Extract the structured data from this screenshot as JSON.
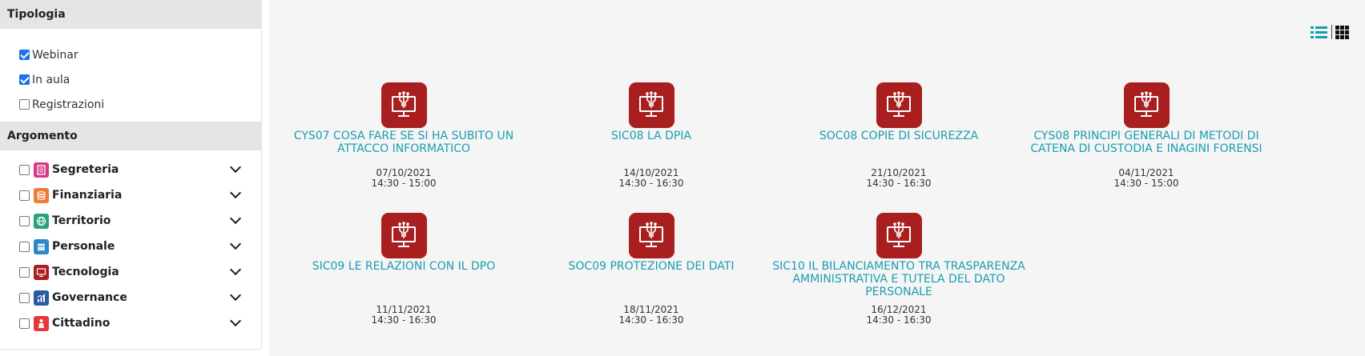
{
  "sidebar": {
    "typology": {
      "title": "Tipologia",
      "items": [
        {
          "label": "Webinar",
          "checked": true
        },
        {
          "label": "In aula",
          "checked": true
        },
        {
          "label": "Registrazioni",
          "checked": false
        }
      ]
    },
    "topic": {
      "title": "Argomento",
      "items": [
        {
          "label": "Segreteria",
          "color": "#d53b84",
          "icon": "document-icon"
        },
        {
          "label": "Finanziaria",
          "color": "#ee7b3a",
          "icon": "coins-icon"
        },
        {
          "label": "Territorio",
          "color": "#27a477",
          "icon": "globe-icon"
        },
        {
          "label": "Personale",
          "color": "#2d88c8",
          "icon": "people-icon"
        },
        {
          "label": "Tecnologia",
          "color": "#a91e1e",
          "icon": "computer-icon"
        },
        {
          "label": "Governance",
          "color": "#285aa6",
          "icon": "chart-icon"
        },
        {
          "label": "Cittadino",
          "color": "#e5373a",
          "icon": "person-icon"
        }
      ]
    }
  },
  "view_toggle": {
    "list_icon": "list-view-icon",
    "grid_icon": "grid-view-icon",
    "accent": "#1a9db0"
  },
  "courses": [
    {
      "title": "CYS07 COSA FARE SE SI HA SUBITO UN ATTACCO INFORMATICO",
      "date": "07/10/2021",
      "time": "14:30 - 15:00"
    },
    {
      "title": "SIC08 LA DPIA",
      "date": "14/10/2021",
      "time": "14:30 - 16:30"
    },
    {
      "title": "SOC08 COPIE DI SICUREZZA",
      "date": "21/10/2021",
      "time": "14:30 - 16:30"
    },
    {
      "title": "CYS08 PRINCIPI GENERALI DI METODI DI CATENA DI CUSTODIA E INAGINI FORENSI",
      "date": "04/11/2021",
      "time": "14:30 - 15:00"
    },
    {
      "title": "SIC09 LE RELAZIONI CON IL DPO",
      "date": "11/11/2021",
      "time": "14:30 - 16:30"
    },
    {
      "title": "SOC09 PROTEZIONE DEI DATI",
      "date": "18/11/2021",
      "time": "14:30 - 16:30"
    },
    {
      "title": "SIC10 IL BILANCIAMENTO TRA TRASPARENZA AMMINISTRATIVA E TUTELA DEL DATO PERSONALE",
      "date": "16/12/2021",
      "time": "14:30 - 16:30"
    }
  ],
  "colors": {
    "course_icon": "#a91e1e",
    "link": "#1a9db0"
  }
}
